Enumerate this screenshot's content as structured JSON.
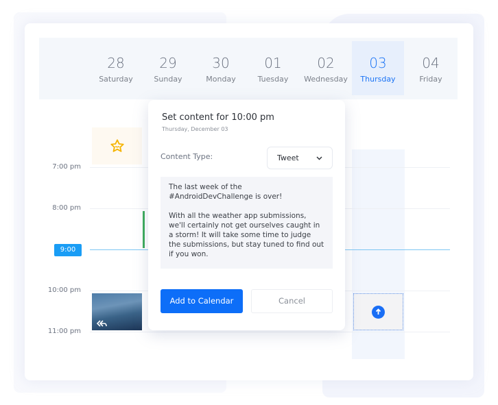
{
  "calendar": {
    "days": [
      {
        "num": "28",
        "name": "Saturday"
      },
      {
        "num": "29",
        "name": "Sunday"
      },
      {
        "num": "30",
        "name": "Monday"
      },
      {
        "num": "01",
        "name": "Tuesday"
      },
      {
        "num": "02",
        "name": "Wednesday"
      },
      {
        "num": "03",
        "name": "Thursday",
        "active": true
      },
      {
        "num": "04",
        "name": "Friday"
      }
    ],
    "times": [
      "7:00 pm",
      "8:00 pm",
      "9:00 pm",
      "10:00 pm",
      "11:00 pm"
    ],
    "current_time": "9:00 pm"
  },
  "modal": {
    "title": "Set content for 10:00 pm",
    "subtitle": "Thursday, December 03",
    "content_type_label": "Content Type:",
    "content_type_value": "Tweet",
    "content_text": "The last week of the #AndroidDevChallenge is over!\n\nWith all the weather app submissions, we'll certainly not get ourselves caught in a storm! It will take some time to judge the submissions, but stay tuned to find out if you won.",
    "add_label": "Add to Calendar",
    "cancel_label": "Cancel"
  },
  "colors": {
    "accent": "#0d6ef8",
    "now_line": "#7cc6f3",
    "star": "#f5b400",
    "event_green": "#3bab5a"
  }
}
